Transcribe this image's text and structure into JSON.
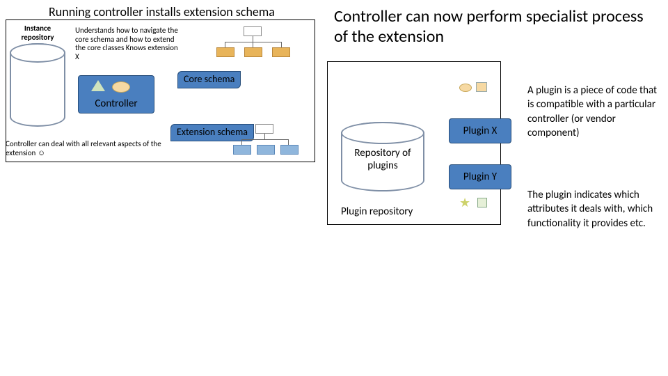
{
  "left": {
    "title": "Running controller installs extension schema",
    "instance_repo": "Instance repository",
    "understands": "Understands how to navigate the core schema and how to extend the core classes Knows extension X",
    "controller": "Controller",
    "core_schema": "Core schema",
    "extension_schema": "Extension schema",
    "footnote": "Controller can deal with all relevant aspects of the extension ☺"
  },
  "right": {
    "title": "Controller can now perform specialist process of the extension",
    "repo_of_plugins": "Repository of plugins",
    "plugin_repo": "Plugin repository",
    "plugin_x": "Plugin X",
    "plugin_y": "Plugin Y",
    "plugin_def": "A plugin is a piece of code that is compatible with a particular controller (or vendor component)",
    "plugin_indicates": "The plugin indicates which attributes it deals with, which functionality it provides etc."
  }
}
